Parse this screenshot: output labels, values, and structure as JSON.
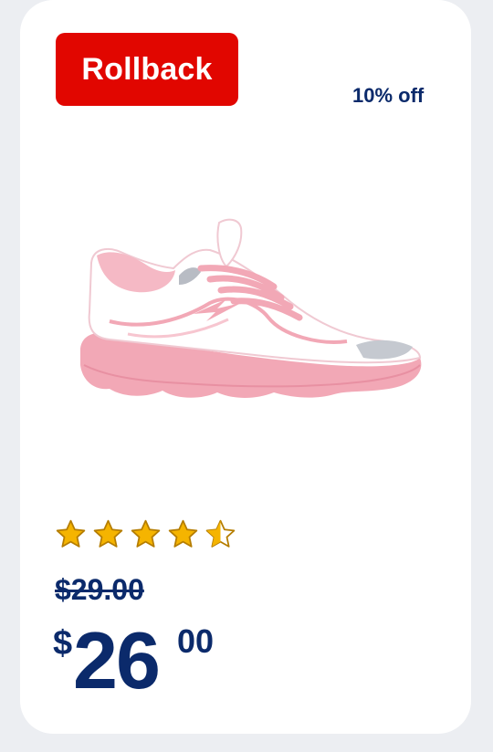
{
  "badge": {
    "label": "Rollback",
    "color": "#e10600"
  },
  "discount": {
    "label": "10% off"
  },
  "product": {
    "image_icon": "pink-white-sneaker-image"
  },
  "rating": {
    "value": 4.5,
    "max": 5,
    "star_color": "#f5b400"
  },
  "price": {
    "was": "$29.00",
    "currency": "$",
    "whole": "26",
    "cents": "00"
  },
  "colors": {
    "text": "#0b2a6b",
    "background": "#eceef2",
    "card": "#ffffff"
  }
}
